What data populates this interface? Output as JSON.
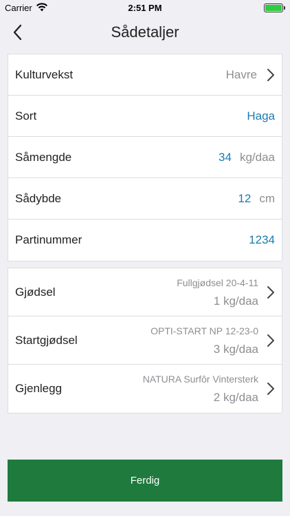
{
  "status": {
    "carrier": "Carrier",
    "time": "2:51 PM"
  },
  "nav": {
    "title": "Sådetaljer",
    "back_icon": "chevron-left-icon"
  },
  "details": {
    "kulturvekst": {
      "label": "Kulturvekst",
      "value": "Havre"
    },
    "sort": {
      "label": "Sort",
      "value": "Haga"
    },
    "samengde": {
      "label": "Såmengde",
      "value": "34",
      "unit": "kg/daa"
    },
    "sadybde": {
      "label": "Sådybde",
      "value": "12",
      "unit": "cm"
    },
    "partinummer": {
      "label": "Partinummer",
      "value": "1234"
    }
  },
  "fertilizer": {
    "gjodsel": {
      "label": "Gjødsel",
      "product": "Fullgjødsel 20-4-11",
      "amount": "1 kg/daa"
    },
    "startgjodsel": {
      "label": "Startgjødsel",
      "product": "OPTI-START NP 12-23-0",
      "amount": "3 kg/daa"
    },
    "gjenlegg": {
      "label": "Gjenlegg",
      "product": "NATURA Surfôr Vintersterk",
      "amount": "2 kg/daa"
    }
  },
  "footer": {
    "done_label": "Ferdig"
  },
  "colors": {
    "accent_blue": "#1a7bb0",
    "button_green": "#1e7a3d",
    "battery_green": "#2ecc40"
  }
}
